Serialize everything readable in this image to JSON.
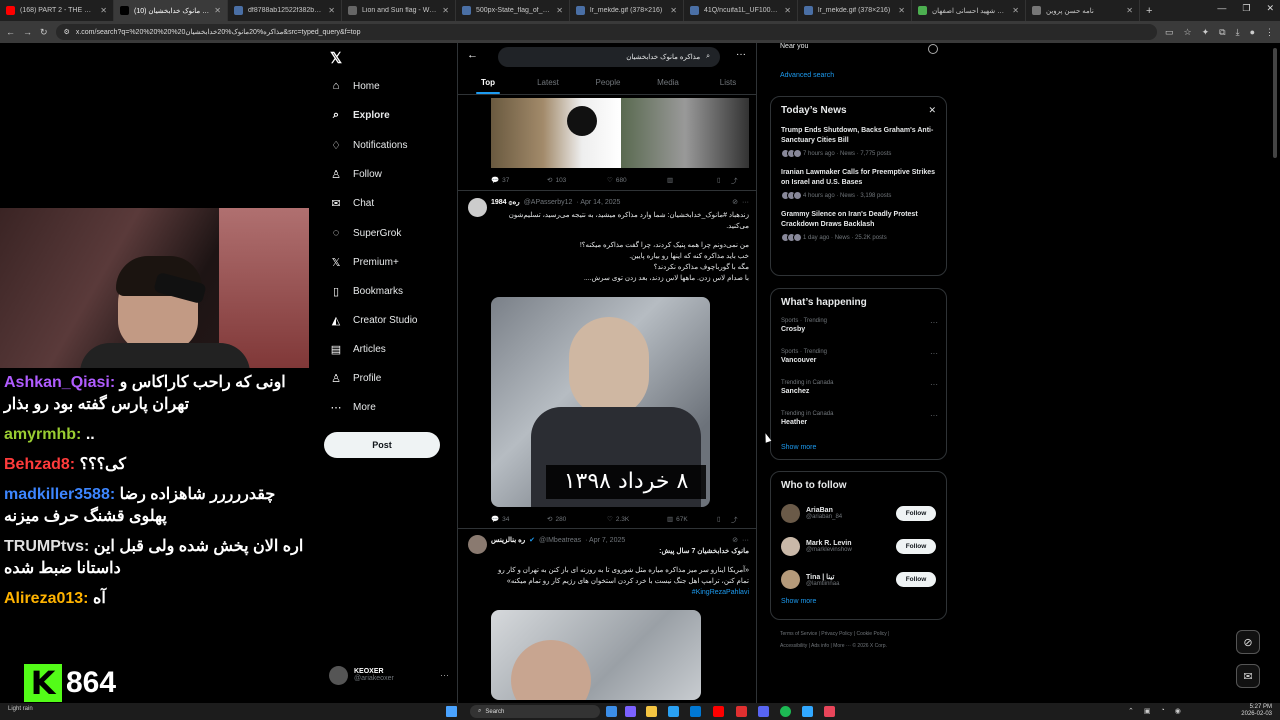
{
  "browser": {
    "tabs": [
      {
        "label": "(168) PART 2 - THE UNSEEN I",
        "color": "#ff0000"
      },
      {
        "label": "مذاکره مانوک خدابخشیان (10)",
        "color": "#000000"
      },
      {
        "label": "df8788ab12522f382bc8613",
        "color": "#4a6fa5"
      },
      {
        "label": "Lion and Sun flag - Wikipedia",
        "color": "#666666"
      },
      {
        "label": "500px-State_flag_of_Iran_(19",
        "color": "#4a6fa5"
      },
      {
        "label": "lr_mekde.gif (378×216)",
        "color": "#4a6fa5"
      },
      {
        "label": "41Q/ncuifa1L_UF1000,1000",
        "color": "#4a6fa5"
      },
      {
        "label": "lr_mekde.gif (378×216)",
        "color": "#4a6fa5"
      },
      {
        "label": "مدرسه شهید احسانی اصفهان",
        "color": "#4caf50"
      },
      {
        "label": "نامه حسن پروین",
        "color": "#777777"
      }
    ],
    "url": "x.com/search?q=%20%20%20%20مذاکره%20مانوک%20خدابخشیان&src=typed_query&f=top"
  },
  "stream": {
    "chat": [
      {
        "user": "Ashkan_Qiasi:",
        "color": "#b05cff",
        "text": "اونی که راحب کاراکاس و تهران پارس گفته بود رو بذار"
      },
      {
        "user": "amyrmhb:",
        "color": "#9acd32",
        "text": ".."
      },
      {
        "user": "Behzad8:",
        "color": "#ff3b3b",
        "text": "کی؟؟؟"
      },
      {
        "user": "madkiller3588:",
        "color": "#3d86ff",
        "text": "چقدررررر شاهزاده رضا پهلوی قشنگ حرف میزنه"
      },
      {
        "user": "TRUMPtvs:",
        "color": "#e0e0e0",
        "text": "اره الان پخش شده ولی قبل این داستانا ضبط شده"
      },
      {
        "user": "Alireza013:",
        "color": "#ffb300",
        "text": "آه"
      }
    ],
    "viewer_count": "864",
    "kick_logo": "K"
  },
  "xnav": {
    "logo": "𝕏",
    "items": [
      {
        "label": "Home",
        "icon": "⌂"
      },
      {
        "label": "Explore",
        "icon": "⌕"
      },
      {
        "label": "Notifications",
        "icon": "♢"
      },
      {
        "label": "Follow",
        "icon": "♙"
      },
      {
        "label": "Chat",
        "icon": "✉"
      },
      {
        "label": "SuperGrok",
        "icon": "◌"
      },
      {
        "label": "Premium+",
        "icon": "𝕏"
      },
      {
        "label": "Bookmarks",
        "icon": "▯"
      },
      {
        "label": "Creator Studio",
        "icon": "◭"
      },
      {
        "label": "Articles",
        "icon": "▤"
      },
      {
        "label": "Profile",
        "icon": "♙"
      },
      {
        "label": "More",
        "icon": "⋯"
      }
    ],
    "post": "Post",
    "account": {
      "name": "KEOXER",
      "handle": "@ariakeoxer"
    }
  },
  "search": {
    "query": "مذاکره مانوک خدابخشیان",
    "tabs": [
      "Top",
      "Latest",
      "People",
      "Media",
      "Lists"
    ]
  },
  "tweets": {
    "t0": {
      "replies": "37",
      "reposts": "103",
      "likes": "680"
    },
    "t1": {
      "name": "1984 ۞ره",
      "handle": "@APasserby12",
      "date": "· Apr 14, 2025",
      "line1": "زندهباد #مانوک_خدابخشیان: شما وارد مذاکره میشید، به نتیجه می‌رسید، تسلیم‌شون",
      "line1b": "می‌کنید.",
      "line2": "من نمی‌دونم چرا همه پنیک کردند، چرا گفت مذاکره میکنه؟!",
      "line3": "خب باید مذاکره کنه که اینها رو بیاره پایین.",
      "line4": "مگه با گورباچوف مذاکره نکردند؟",
      "line5": "با صدام لاس زدن. ماهها لاس زدند، بعد زدن توی سرش....",
      "caption": "۸ خرداد ۱۳۹۸",
      "replies": "34",
      "reposts": "280",
      "likes": "2.3K",
      "views": "67K"
    },
    "t2": {
      "name": "ره بنالزینس",
      "handle": "@IMbeatreas",
      "date": "· Apr 7, 2025",
      "line1": "مانوک خدابخشیان 7 سال پیش:",
      "line2": "«آمریکا اینارو سر میز مذاکره میاره مثل شوروی تا به روزنه ای باز کنن به تهران و کار رو",
      "line3": "تمام کنن، ترامپ اهل جنگ نیست با خرد کردن استخوان های رژیم کار رو تمام میکنه»",
      "hashtag": "#KingRezaPahlavi"
    }
  },
  "right": {
    "near": "Near you",
    "advanced": "Advanced search",
    "news_title": "Today’s News",
    "news": [
      {
        "title": "Trump Ends Shutdown, Backs Graham's Anti-Sanctuary Cities Bill",
        "meta": "7 hours ago · News · 7,775 posts"
      },
      {
        "title": "Iranian Lawmaker Calls for Preemptive Strikes on Israel and U.S. Bases",
        "meta": "4 hours ago · News · 3,198 posts"
      },
      {
        "title": "Grammy Silence on Iran's Deadly Protest Crackdown Draws Backlash",
        "meta": "1 day ago · News · 25.2K posts"
      }
    ],
    "happening_title": "What’s happening",
    "trends": [
      {
        "context": "Sports · Trending",
        "name": "Crosby"
      },
      {
        "context": "Sports · Trending",
        "name": "Vancouver"
      },
      {
        "context": "Trending in Canada",
        "name": "Sanchez"
      },
      {
        "context": "Trending in Canada",
        "name": "Heather"
      }
    ],
    "show_more": "Show more",
    "who_title": "Who to follow",
    "who": [
      {
        "name": "AriaBan",
        "handle": "@ariaban_84",
        "btn": "Follow"
      },
      {
        "name": "Mark R. Levin",
        "handle": "@marklevinshow",
        "btn": "Follow"
      },
      {
        "name": "Tina | تینا",
        "handle": "@lamtiinnaa",
        "btn": "Follow"
      }
    ],
    "footer1": "Terms of Service  |  Privacy Policy  |  Cookie Policy  |",
    "footer2": "Accessibility  |  Ads info  |  More ···  © 2026 X Corp."
  },
  "taskbar": {
    "weather": "Light rain",
    "search": "Search",
    "time": "5:27 PM",
    "date": "2026-02-03"
  }
}
